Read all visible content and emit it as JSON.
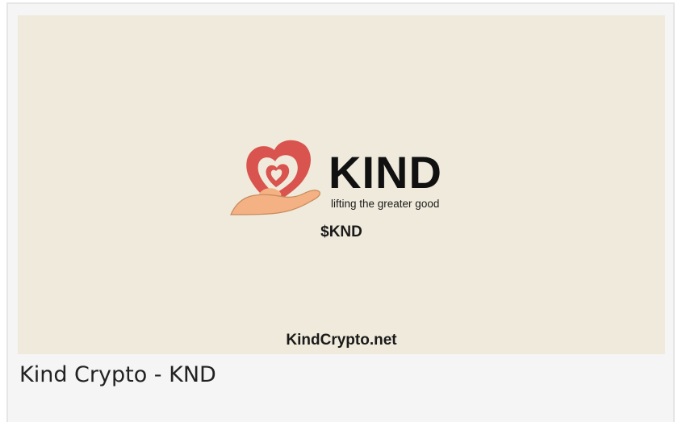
{
  "card": {
    "caption": "Kind Crypto - KND"
  },
  "banner": {
    "brand": "KIND",
    "tagline": "lifting the greater good",
    "ticker": "$KND",
    "website": "KindCrypto.net",
    "background_color": "#efeadb"
  },
  "logo": {
    "icon": "heart-in-hand-icon",
    "heart_color": "#d9534f",
    "hand_color": "#f4b183"
  }
}
